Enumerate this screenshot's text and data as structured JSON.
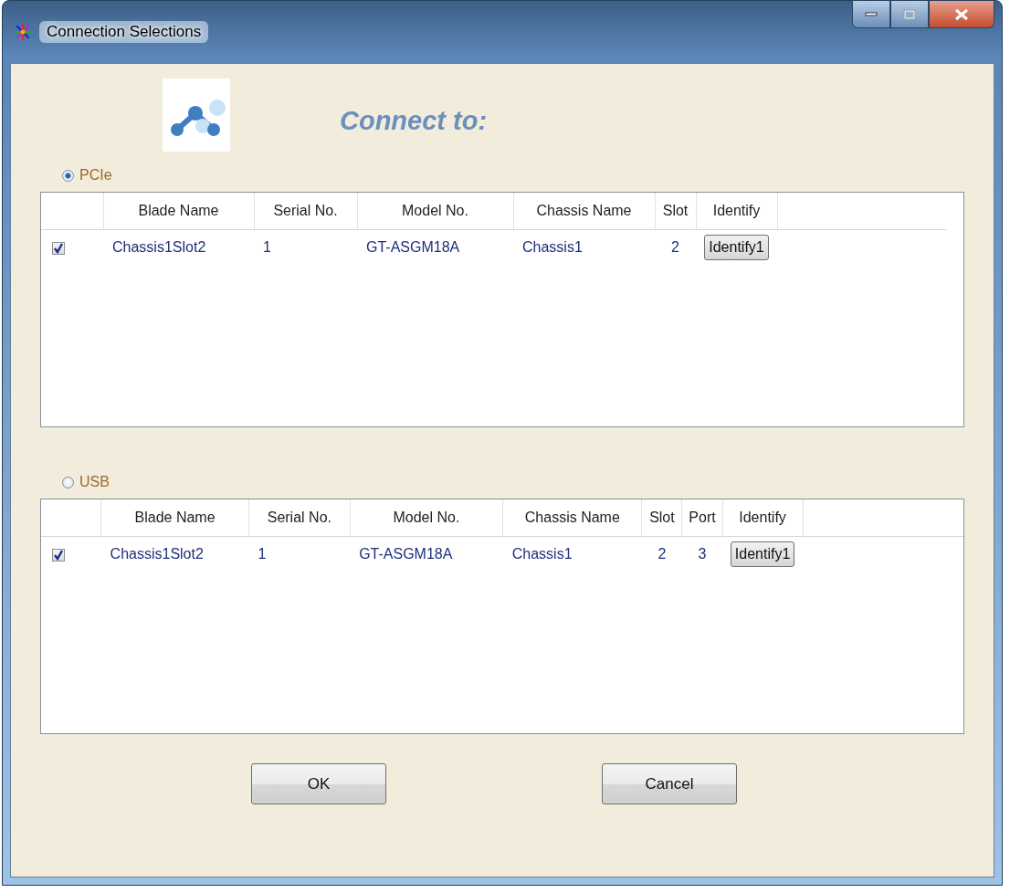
{
  "window": {
    "title": "Connection Selections"
  },
  "heading": "Connect to:",
  "sections": [
    {
      "radio": {
        "label": "PCIe",
        "selected": true
      },
      "grid": {
        "columns": [
          "Blade Name",
          "Serial No.",
          "Model No.",
          "Chassis Name",
          "Slot",
          "Identify"
        ],
        "rows": [
          {
            "checked": true,
            "cells": [
              "Chassis1Slot2",
              "1",
              "GT-ASGM18A",
              "Chassis1",
              "2"
            ],
            "identify": "Identify1"
          }
        ]
      }
    },
    {
      "radio": {
        "label": "USB",
        "selected": false
      },
      "grid": {
        "columns": [
          "Blade Name",
          "Serial No.",
          "Model No.",
          "Chassis Name",
          "Slot",
          "Port",
          "Identify"
        ],
        "rows": [
          {
            "checked": true,
            "cells": [
              "Chassis1Slot2",
              "1",
              "GT-ASGM18A",
              "Chassis1",
              "2",
              "3"
            ],
            "identify": "Identify1"
          }
        ]
      }
    }
  ],
  "buttons": [
    "OK",
    "Cancel"
  ]
}
